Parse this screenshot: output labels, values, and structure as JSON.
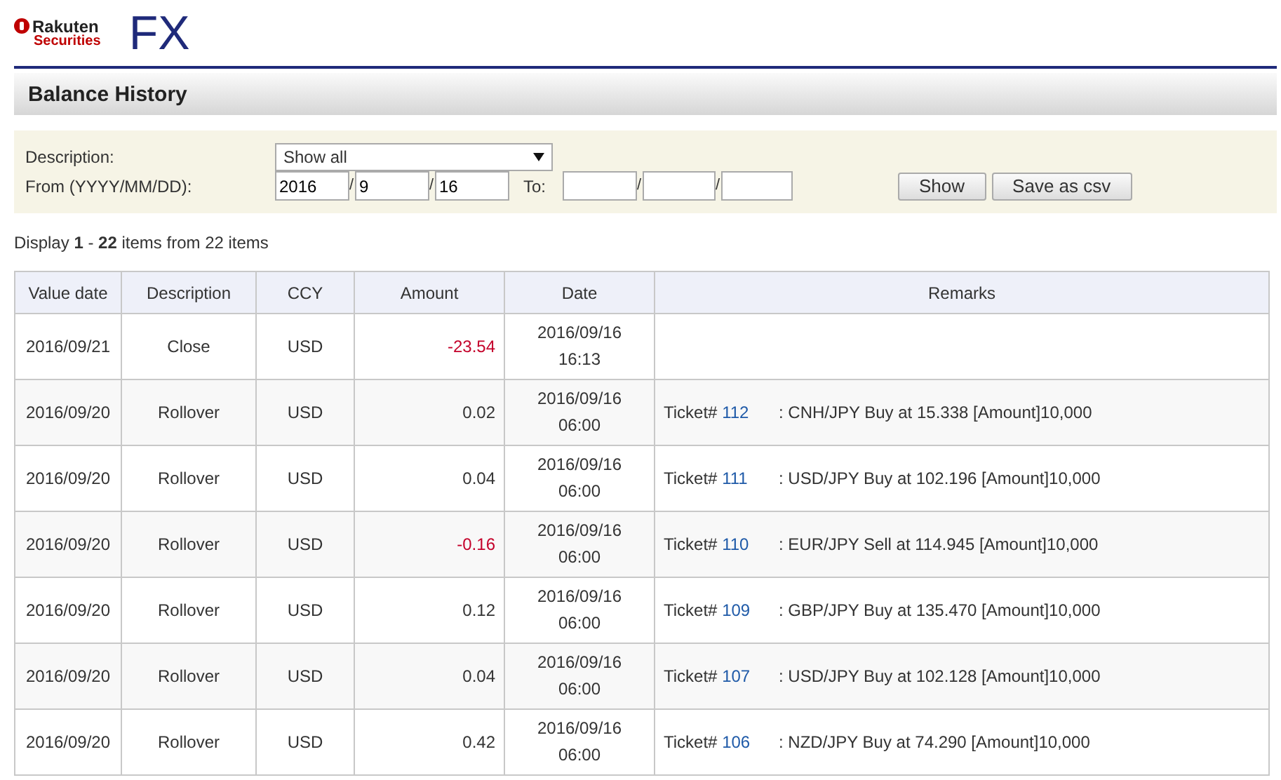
{
  "header": {
    "brand_line_1": "Rakuten",
    "brand_line_2": "Securities",
    "product": "FX"
  },
  "page_title": "Balance History",
  "filter": {
    "description_label": "Description:",
    "description_value": "Show all",
    "from_label": "From (YYYY/MM/DD):",
    "from": [
      "2016",
      "9",
      "16"
    ],
    "separators": [
      "/",
      "/",
      "/",
      "/"
    ],
    "to_label": "To:",
    "to_fields": [
      {
        "kind": "year"
      },
      {
        "kind": "month"
      },
      {
        "kind": "day"
      }
    ],
    "buttons": [
      "Show",
      "Save as csv"
    ]
  },
  "summary": "Display **1** - **22** items from 22 items",
  "table": {
    "columns": [
      "Value date",
      "Description",
      "CCY",
      "Amount",
      "Date",
      "Remarks"
    ],
    "rows": [
      {
        "value_date": "2016/09/21",
        "description": "Close",
        "ccy": "USD",
        "amount": "-23.54",
        "negative": true,
        "date": "2016/09/16",
        "time": "16:13"
      },
      {
        "value_date": "2016/09/20",
        "description": "Rollover",
        "ccy": "USD",
        "amount": "0.02",
        "negative": false,
        "date": "2016/09/16",
        "time": "06:00",
        "ticket_label": "Ticket#",
        "ticket": "112",
        "remark": ": CNH/JPY Buy at 15.338 [Amount]10,000"
      },
      {
        "value_date": "2016/09/20",
        "description": "Rollover",
        "ccy": "USD",
        "amount": "0.04",
        "negative": false,
        "date": "2016/09/16",
        "time": "06:00",
        "ticket_label": "Ticket#",
        "ticket": "111",
        "remark": ": USD/JPY Buy at 102.196 [Amount]10,000"
      },
      {
        "value_date": "2016/09/20",
        "description": "Rollover",
        "ccy": "USD",
        "amount": "-0.16",
        "negative": true,
        "date": "2016/09/16",
        "time": "06:00",
        "ticket_label": "Ticket#",
        "ticket": "110",
        "remark": ": EUR/JPY Sell at 114.945 [Amount]10,000"
      },
      {
        "value_date": "2016/09/20",
        "description": "Rollover",
        "ccy": "USD",
        "amount": "0.12",
        "negative": false,
        "date": "2016/09/16",
        "time": "06:00",
        "ticket_label": "Ticket#",
        "ticket": "109",
        "remark": ": GBP/JPY Buy at 135.470 [Amount]10,000"
      },
      {
        "value_date": "2016/09/20",
        "description": "Rollover",
        "ccy": "USD",
        "amount": "0.04",
        "negative": false,
        "date": "2016/09/16",
        "time": "06:00",
        "ticket_label": "Ticket#",
        "ticket": "107",
        "remark": ": USD/JPY Buy at 102.128 [Amount]10,000"
      },
      {
        "value_date": "2016/09/20",
        "description": "Rollover",
        "ccy": "USD",
        "amount": "0.42",
        "negative": false,
        "date": "2016/09/16",
        "time": "06:00",
        "ticket_label": "Ticket#",
        "ticket": "106",
        "remark": ": NZD/JPY Buy at 74.290 [Amount]10,000"
      }
    ]
  }
}
